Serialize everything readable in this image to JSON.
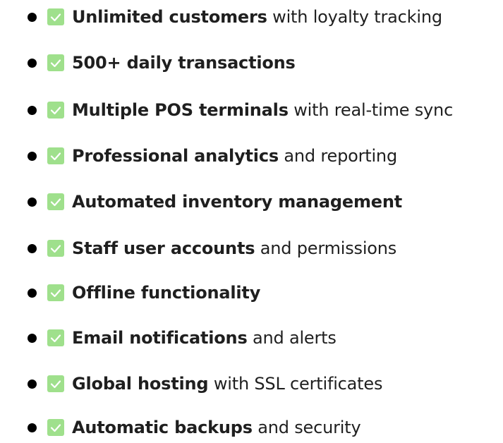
{
  "colors": {
    "check_fill": "#9fe08c",
    "check_mark": "#ffffff",
    "text": "#1f1f1f",
    "bullet": "#000000"
  },
  "icons": {
    "bullet": "bullet-icon",
    "check": "check-box-icon"
  },
  "features": [
    {
      "bold": "Unlimited customers",
      "rest": " with loyalty tracking"
    },
    {
      "bold": "500+ daily transactions",
      "rest": ""
    },
    {
      "bold": "Multiple POS terminals",
      "rest": " with real-time sync"
    },
    {
      "bold": "Professional analytics",
      "rest": " and reporting"
    },
    {
      "bold": "Automated inventory management",
      "rest": ""
    },
    {
      "bold": "Staff user accounts",
      "rest": " and permissions"
    },
    {
      "bold": "Offline functionality",
      "rest": ""
    },
    {
      "bold": "Email notifications",
      "rest": " and alerts"
    },
    {
      "bold": "Global hosting",
      "rest": " with SSL certificates"
    },
    {
      "bold": "Automatic backups",
      "rest": " and security"
    }
  ]
}
